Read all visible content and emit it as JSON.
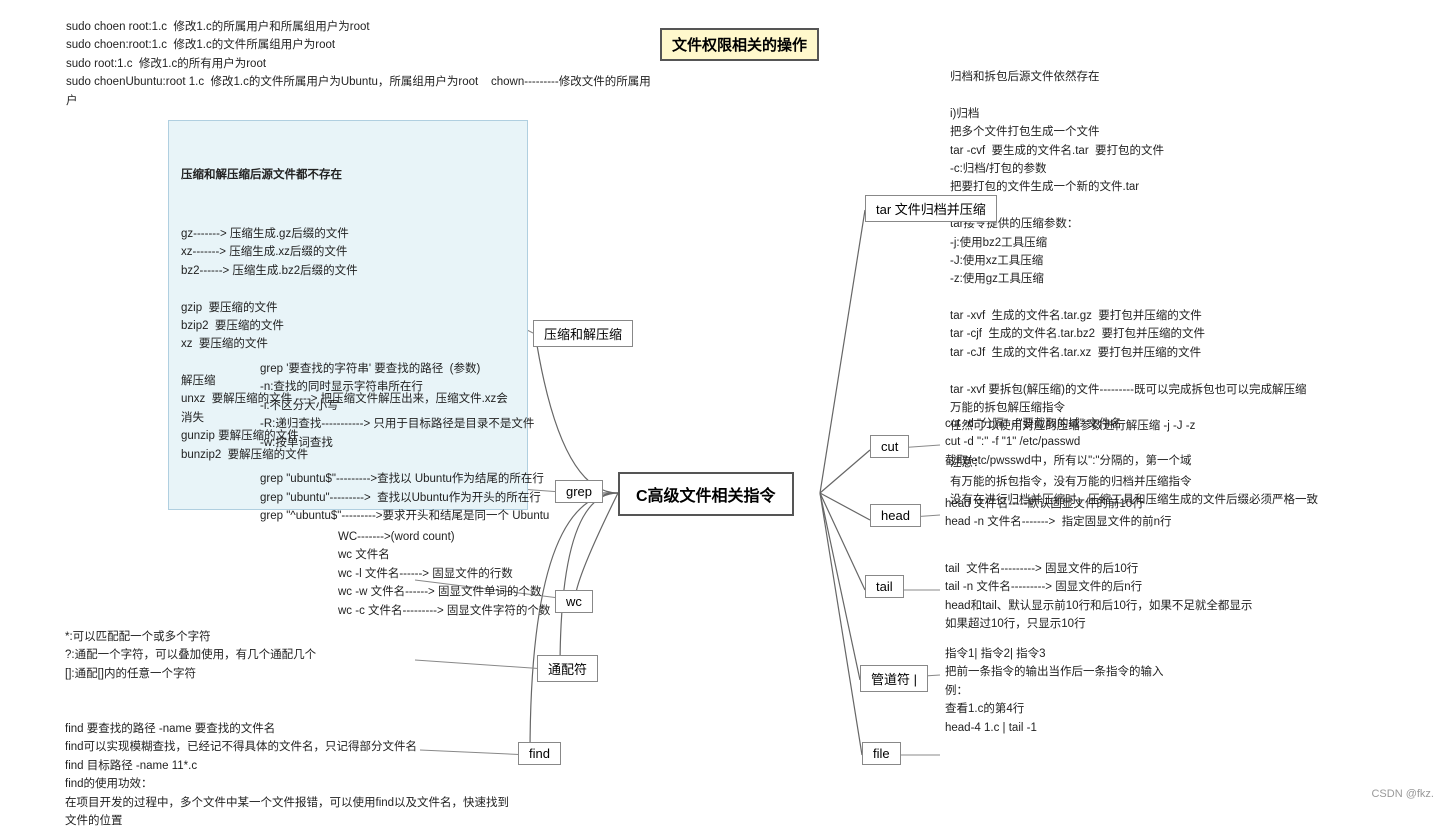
{
  "title": "C高级文件相关指令",
  "nodes": {
    "center": "C高级文件相关指令",
    "compress": "压缩和解压缩",
    "tar": "tar 文件归档并压缩",
    "cut": "cut",
    "head": "head",
    "tail": "tail",
    "pipe": "管道符 |",
    "file": "file",
    "grep": "grep",
    "wc": "wc",
    "wildcard": "通配符",
    "find": "find"
  },
  "content": {
    "top_commands": "sudo choen root:1.c  修改1.c的所属用户和所属组用户为root\nsudo choen:root:1.c  修改1.c的文件所属组用户为root\nsudo root:1.c  修改1.c的所有用户为root\nsudo choenUbuntu:root 1.c  修改1.c的文件所属用户为Ubuntu，所属组用户为root    chown---------修改文件的所属用户",
    "file_permission_title": "文件权限相关的操作",
    "compress_box_title": "压缩和解压缩后源文件都不存在",
    "compress_box_content": "gz-------> 压缩生成.gz后缀的文件\nxz-------> 压缩生成.xz后缀的文件\nbz2------> 压缩生成.bz2后缀的文件\n\ngzip  要压缩的文件\nbzip2  要压缩的文件\nxz  要压缩的文件\n\n解压缩\nunxz  要解压缩的文件 ----> 把压缩文件解压出来，压缩文件.xz会消失\ngunzip 要解压缩的文件\nbunzip2  要解压缩的文件",
    "tar_right": "归档和拆包后源文件依然存在\n\ni)归档\n把多个文件打包生成一个文件\ntar -cvf  要生成的文件名.tar  要打包的文件\n-c:归档/打包的参数\n把要打包的文件生成一个新的文件.tar\n\ntar接令提供的压缩参数：\n-j:使用bz2工具压缩\n-J:使用xz工具压缩\n-z:使用gz工具压缩\n\ntar -xvf  生成的文件名.tar.gz  要打包并压缩的文件\ntar -cjf  生成的文件名.tar.bz2  要打包并压缩的文件\ntar -cJf  生成的文件名.tar.xz  要打包并压缩的文件\n\ntar -xvf 要拆包(解压缩)的文件---------既可以完成拆包也可以完成解压缩\n万能的拆包解压缩指令\n任然可 以使用对应的压缩参数进行解压缩 -j -J -z\n\n注意：\n有万能的拆包指令，没有万能的归档并压缩指令\n没有在进行归档并压缩时，压缩工具和压缩生成的文件后缀必须严格一致",
    "cut_content": "cut -d \"分隔\" -f\"要截取的域\" 文件名\ncut -d \":\" -f \"1\" /etc/passwd\n截取/etc/pwsswd中，所有以\":\"分隔的，第一个域",
    "head_content": "head 文件名-----默认固显文件的前10行\nhead -n 文件名------->  指定固显文件的前n行",
    "tail_content": "tail  文件名---------> 固显文件的后10行\ntail -n 文件名---------> 固显文件的后n行\nhead和tail、默认显示前10行和后10行，如果不足就全都显示\n如果超过10行，只显示10行",
    "pipe_content": "指令1| 指令2| 指令3\n把前一条指令的输出当作后一条指令的输入\n例：\n查看1.c的第4行\nhead-4 1.c | tail -1",
    "grep_content": "grep '要查找的字符串' 要查找的路径  (参数)\n-n:查找的同时显示字符串所在行\n-i:不区分大小写\n-R:递归查找-----------> 只用于目标路径是目录不是文件\n-w:按单词查找\n\ngrep \"ubuntu$\"--------->查找以 Ubuntu作为结尾的所在行\ngrep \"ubuntu\"--------->  查找以Ubuntu作为开头的所在行\ngrep \"^ubuntu$\"--------->要求开头和结尾是同一个 Ubuntu",
    "wc_content": "WC------->(word count)\nwc 文件名\nwc -l 文件名------> 固显文件的行数\nwc -w 文件名------> 固显文件单词的个数\nwc -c 文件名---------> 固显文件字符的个数",
    "wildcard_content": "*:可以匹配配一个或多个字符\n?:通配一个字符，可以叠加使用，有几个通配几个\n[]:通配[]内的任意一个字符",
    "find_content": "find 要查找的路径 -name 要查找的文件名\nfind可以实现模糊查找，已经记不得具体的文件名，只记得部分文件名\nfind 目标路径 -name 11*.c\nfind的使用功效：\n在项目开发的过程中，多个文件中某一个文件报错，可以使用find以及文件名，快速找到文件的位置"
  },
  "watermark": "CSDN @fkz."
}
